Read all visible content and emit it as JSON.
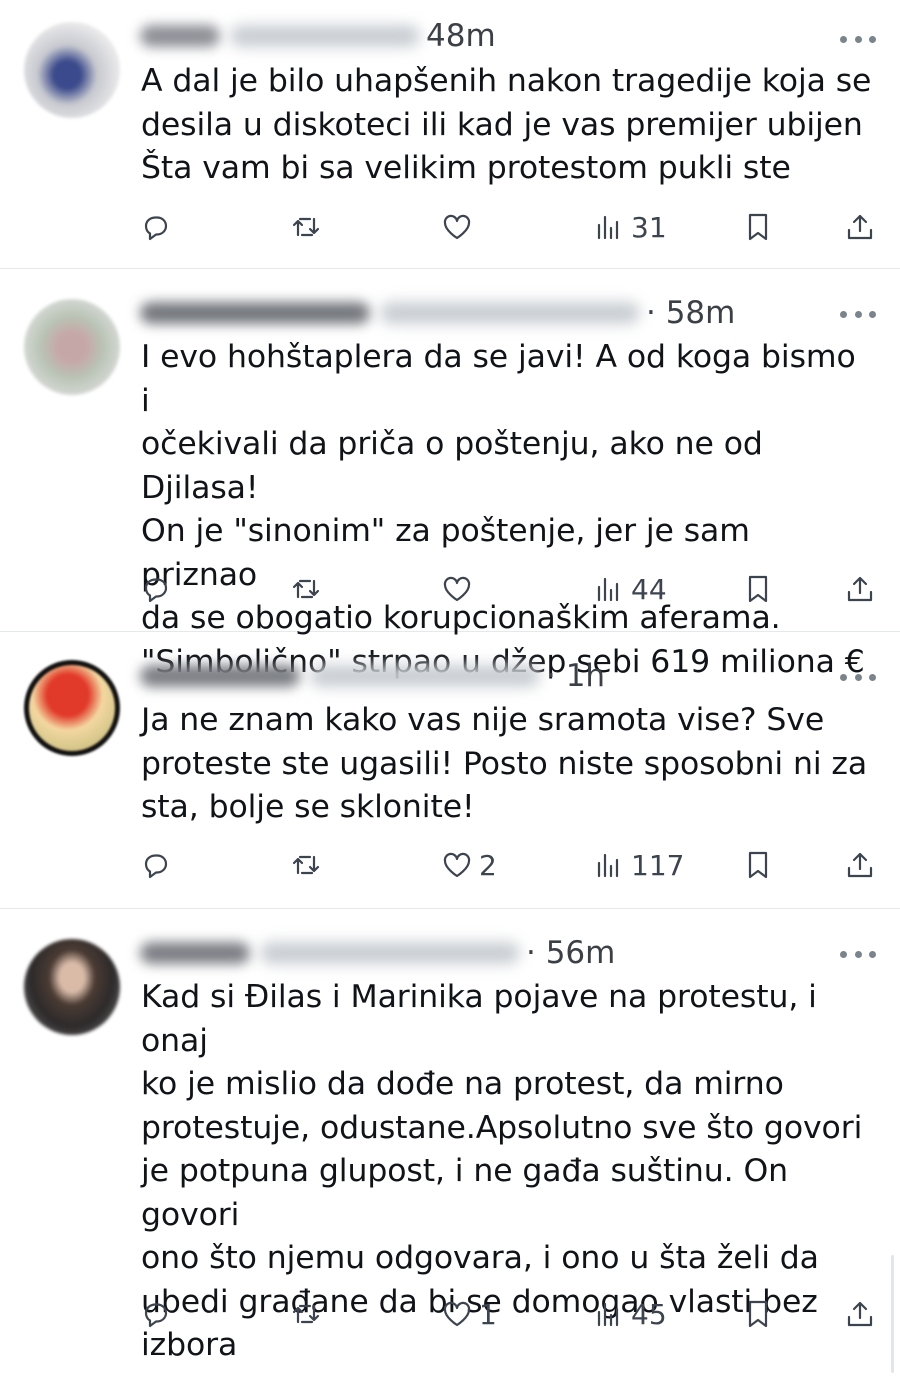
{
  "replies": [
    {
      "time": "48m",
      "text": "A dal je bilo uhapšenih nakon tragedije koja se\ndesila u diskoteci ili kad je vas premijer ubijen\nŠta vam bi sa velikim protestom pukli ste",
      "stats": {
        "replies": "",
        "reposts": "",
        "likes": "",
        "views": "31"
      }
    },
    {
      "time": "· 58m",
      "text": "I evo hohštaplera da se javi! A od koga bismo i\nočekivali da priča o poštenju, ako ne od Djilasa!\nOn je \"sinonim\" za poštenje, jer je sam priznao\nda se obogatio korupcionaškim aferama.\n\"Simbolično\" strpao u džep sebi 619 miliona €",
      "stats": {
        "replies": "",
        "reposts": "",
        "likes": "",
        "views": "44"
      }
    },
    {
      "time": "· 1h",
      "text": "Ja ne znam kako vas nije sramota vise? Sve\nproteste ste ugasili! Posto niste sposobni ni za\nsta, bolje se sklonite!",
      "stats": {
        "replies": "",
        "reposts": "",
        "likes": "2",
        "views": "117"
      }
    },
    {
      "time": "· 56m",
      "text": "Kad si Đilas i Marinika pojave na protestu, i onaj\nko je mislio da dođe na protest, da mirno\nprotestuje, odustane.Apsolutno sve što govori\nje potpuna glupost, i ne gađa suštinu. On govori\nono što njemu odgovara, i ono u šta želi da\nubedi građane da bi se domogao vlasti bez\nizbora",
      "stats": {
        "replies": "",
        "reposts": "",
        "likes": "1",
        "views": "45"
      }
    }
  ],
  "icons": {
    "reply": "reply-icon",
    "repost": "repost-icon",
    "like": "heart-icon",
    "views": "views-icon",
    "bookmark": "bookmark-icon",
    "share": "share-icon",
    "more": "more-icon"
  },
  "colors": {
    "text": "#0f1419",
    "secondary": "#3c4450",
    "divider": "#e6e9ec"
  }
}
